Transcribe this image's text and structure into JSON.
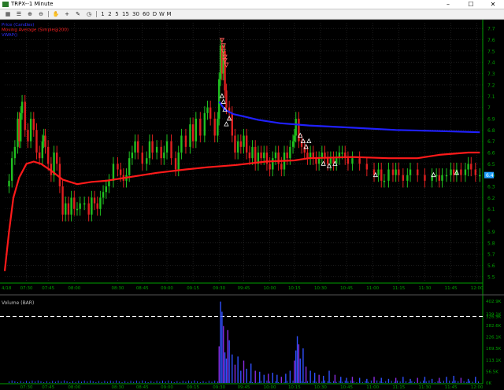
{
  "window": {
    "title": "TRPX--1 Minute",
    "minimize_glyph": "–",
    "maximize_glyph": "☐",
    "close_glyph": "✕"
  },
  "toolbar": {
    "icons": [
      "grid-icon",
      "list-icon",
      "zoom-in-icon",
      "zoom-out-icon",
      "hand-icon",
      "add-icon",
      "pencil-icon",
      "clock-icon"
    ],
    "icon_glyphs": [
      "▦",
      "☰",
      "⊕",
      "⊖",
      "✋",
      "+",
      "✎",
      "◷"
    ],
    "intervals": [
      "1",
      "2",
      "5",
      "15",
      "30",
      "60",
      "D",
      "W",
      "M"
    ]
  },
  "colors": {
    "background": "#000000",
    "up": "#20c020",
    "down": "#e02020",
    "ma": "#ff1a1a",
    "vwap": "#2020ff",
    "volume": "#8a2be2",
    "axis": "#00a000",
    "grid": "#2e2e2e"
  },
  "chart_data": [
    {
      "type": "line",
      "title": "",
      "legend": [
        "Price (Candles)",
        "Moving Average (Simple@200)",
        "VWAP()"
      ],
      "legend_colors": [
        "#3030ff",
        "#ff2020",
        "#3030ff"
      ],
      "legend_placement": "top-left",
      "date_label": "4/18",
      "x_tick_labels": [
        "07:30",
        "07:45",
        "08:00",
        "08:30",
        "08:45",
        "09:00",
        "09:15",
        "09:30",
        "09:45",
        "10:00",
        "10:15",
        "10:30",
        "10:45",
        "11:00",
        "11:15",
        "11:30",
        "11:45",
        "12:00"
      ],
      "y_tick_labels": [
        "7.7",
        "7.6",
        "7.5",
        "7.4",
        "7.3",
        "7.2",
        "7.1",
        "7",
        "6.9",
        "6.8",
        "6.7",
        "6.6",
        "6.5",
        "6.4",
        "6.3",
        "6.2",
        "6.1",
        "6",
        "5.9",
        "5.8",
        "5.7",
        "5.6",
        "5.5"
      ],
      "last_price_label": "6.4",
      "series": [
        {
          "name": "Moving Average (Simple@200)",
          "x": [
            0,
            3,
            6,
            10,
            15,
            20,
            25,
            32,
            40,
            50,
            60,
            70,
            80,
            95,
            105,
            125,
            140,
            160,
            180,
            200,
            210,
            240,
            265,
            285,
            300,
            320,
            328
          ],
          "values": [
            5.55,
            5.9,
            6.2,
            6.38,
            6.5,
            6.52,
            6.5,
            6.44,
            6.36,
            6.32,
            6.34,
            6.35,
            6.37,
            6.4,
            6.42,
            6.45,
            6.47,
            6.49,
            6.52,
            6.53,
            6.55,
            6.56,
            6.55,
            6.55,
            6.58,
            6.6,
            6.6
          ]
        },
        {
          "name": "VWAP()",
          "x": [
            148,
            152,
            158,
            165,
            175,
            190,
            210,
            240,
            270,
            300,
            328
          ],
          "values": [
            7.05,
            6.98,
            6.94,
            6.92,
            6.89,
            6.86,
            6.84,
            6.82,
            6.8,
            6.79,
            6.78
          ]
        },
        {
          "name": "Price (Candles)",
          "x": [
            3,
            5,
            7,
            9,
            10,
            11,
            12,
            14,
            16,
            18,
            20,
            22,
            24,
            26,
            27,
            28,
            30,
            32,
            34,
            36,
            38,
            40,
            42,
            44,
            46,
            48,
            50,
            52,
            55,
            58,
            60,
            62,
            64,
            66,
            68,
            70,
            72,
            75,
            78,
            80,
            82,
            84,
            86,
            88,
            90,
            92,
            95,
            98,
            100,
            102,
            105,
            108,
            110,
            112,
            115,
            118,
            120,
            122,
            125,
            128,
            130,
            132,
            135,
            138,
            140,
            142,
            145,
            147,
            148,
            149,
            150,
            151,
            152,
            153,
            155,
            157,
            159,
            161,
            163,
            165,
            167,
            169,
            171,
            173,
            175,
            177,
            179,
            181,
            183,
            185,
            187,
            189,
            191,
            193,
            195,
            197,
            199,
            200,
            201,
            203,
            205,
            207,
            209,
            211,
            213,
            215,
            217,
            219,
            221,
            223,
            225,
            227,
            229,
            231,
            233,
            235,
            237,
            240,
            245,
            250,
            255,
            258,
            260,
            262,
            265,
            268,
            270,
            272,
            275,
            278,
            280,
            285,
            290,
            295,
            298,
            300,
            302,
            305,
            308,
            310,
            312,
            315,
            318,
            320,
            322,
            325,
            328
          ],
          "values": [
            6.35,
            6.55,
            6.65,
            6.9,
            6.7,
            6.95,
            7.05,
            6.8,
            6.7,
            6.9,
            6.8,
            6.6,
            6.55,
            6.7,
            6.75,
            6.65,
            6.5,
            6.4,
            6.6,
            6.5,
            6.3,
            6.05,
            6.15,
            6.05,
            6.2,
            6.1,
            6.1,
            6.15,
            6.15,
            6.05,
            6.2,
            6.15,
            6.1,
            6.2,
            6.25,
            6.3,
            6.35,
            6.5,
            6.45,
            6.4,
            6.35,
            6.4,
            6.55,
            6.6,
            6.7,
            6.6,
            6.5,
            6.55,
            6.7,
            6.6,
            6.65,
            6.55,
            6.6,
            6.7,
            6.55,
            6.45,
            6.6,
            6.75,
            6.65,
            6.85,
            6.7,
            6.9,
            6.75,
            6.95,
            7.0,
            6.9,
            6.75,
            6.9,
            7.25,
            7.55,
            7.3,
            7.5,
            7.15,
            7.0,
            6.95,
            6.75,
            6.6,
            6.7,
            6.65,
            6.75,
            6.6,
            6.55,
            6.65,
            6.5,
            6.6,
            6.55,
            6.6,
            6.5,
            6.45,
            6.55,
            6.6,
            6.5,
            6.45,
            6.6,
            6.55,
            6.65,
            6.7,
            6.75,
            6.9,
            6.7,
            6.65,
            6.6,
            6.55,
            6.6,
            6.55,
            6.5,
            6.55,
            6.6,
            6.55,
            6.5,
            6.55,
            6.5,
            6.55,
            6.6,
            6.6,
            6.55,
            6.5,
            6.55,
            6.5,
            6.45,
            6.4,
            6.45,
            6.35,
            6.35,
            6.45,
            6.4,
            6.45,
            6.4,
            6.35,
            6.4,
            6.45,
            6.4,
            6.35,
            6.4,
            6.4,
            6.35,
            6.4,
            6.4,
            6.45,
            6.4,
            6.45,
            6.4,
            6.45,
            6.5,
            6.45,
            6.4,
            6.4
          ]
        }
      ],
      "markers": {
        "down": {
          "x": [
            150,
            151,
            151,
            152,
            152,
            153
          ],
          "values": [
            7.6,
            7.55,
            7.5,
            7.45,
            7.42,
            7.38
          ]
        },
        "up": {
          "x": [
            150,
            151,
            152,
            153,
            155
          ],
          "values": [
            7.1,
            7.05,
            6.98,
            6.85,
            6.9
          ]
        },
        "mid_up": {
          "x": [
            204,
            206,
            208,
            210,
            220,
            224,
            228
          ],
          "values": [
            6.75,
            6.7,
            6.65,
            6.7,
            6.5,
            6.48,
            6.5
          ]
        },
        "late_up": {
          "x": [
            256,
            296,
            312
          ],
          "values": [
            6.4,
            6.4,
            6.42
          ]
        }
      },
      "ylim": [
        5.45,
        7.75
      ],
      "xlim": [
        0,
        330
      ],
      "grid": true
    },
    {
      "type": "bar",
      "title": "Volume (BAR)",
      "y_tick_labels": [
        "402.9K",
        "339.1K",
        "326.9K",
        "282.6K",
        "226.1K",
        "169.5K",
        "113.1K",
        "56.5K",
        "0K"
      ],
      "threshold_value": 326.9,
      "ylim": [
        0,
        410
      ],
      "x": [
        148,
        149,
        150,
        151,
        152,
        153,
        154,
        155,
        157,
        159,
        161,
        163,
        165,
        167,
        170,
        173,
        176,
        179,
        182,
        185,
        188,
        191,
        194,
        197,
        200,
        201,
        202,
        203,
        204,
        206,
        208,
        211,
        214,
        217,
        220,
        224,
        228,
        232,
        236,
        240,
        245,
        250,
        255,
        260,
        265,
        270,
        275,
        280,
        285,
        290,
        295,
        300,
        305,
        310,
        315,
        320,
        325
      ],
      "values": [
        180,
        400,
        350,
        280,
        150,
        120,
        260,
        210,
        140,
        90,
        130,
        60,
        110,
        70,
        95,
        60,
        55,
        40,
        45,
        50,
        40,
        30,
        45,
        60,
        110,
        160,
        230,
        190,
        120,
        170,
        80,
        60,
        50,
        40,
        35,
        60,
        40,
        30,
        25,
        30,
        25,
        20,
        30,
        25,
        20,
        25,
        30,
        20,
        25,
        30,
        20,
        25,
        30,
        35,
        25,
        20,
        30
      ]
    }
  ]
}
